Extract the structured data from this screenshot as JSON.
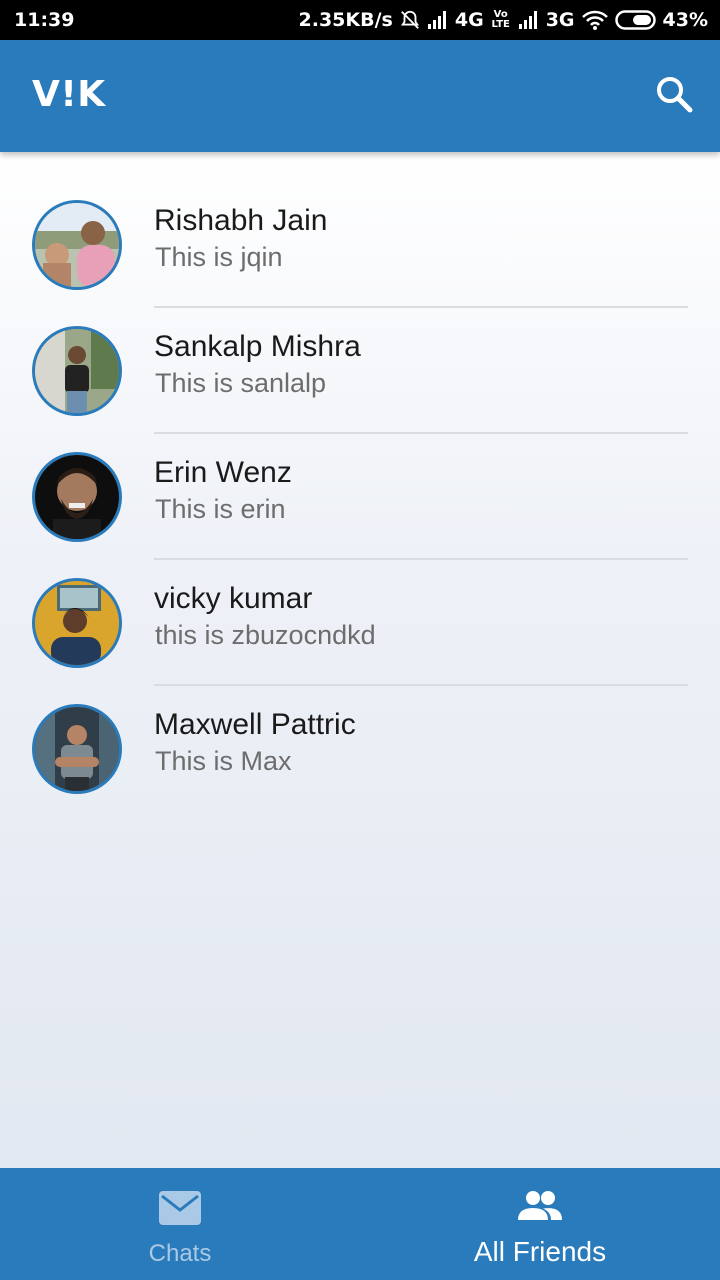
{
  "status_bar": {
    "time": "11:39",
    "net_speed": "2.35KB/s",
    "network1": "4G",
    "volte": "Vo LTE",
    "network2": "3G",
    "battery": "43%"
  },
  "app_bar": {
    "title": "V!K",
    "search_icon": "search-icon"
  },
  "friends": [
    {
      "name": "Rishabh Jain",
      "status": "This is jqin",
      "avatar_color": "#c9a98e"
    },
    {
      "name": "Sankalp Mishra",
      "status": "This is sanlalp",
      "avatar_color": "#7c8d6a"
    },
    {
      "name": "Erin Wenz",
      "status": "This is erin",
      "avatar_color": "#1a1a1a"
    },
    {
      "name": "vicky kumar",
      "status": "this is zbuzocndkd",
      "avatar_color": "#d9a52d"
    },
    {
      "name": "Maxwell Pattric",
      "status": "This is Max",
      "avatar_color": "#3e5260"
    }
  ],
  "bottom_nav": {
    "chats": {
      "label": "Chats",
      "icon": "mail-icon",
      "active": false
    },
    "all_friends": {
      "label": "All Friends",
      "icon": "people-icon",
      "active": true
    }
  },
  "colors": {
    "primary": "#2a7bbb",
    "inactive_nav": "#a9c9e6"
  }
}
